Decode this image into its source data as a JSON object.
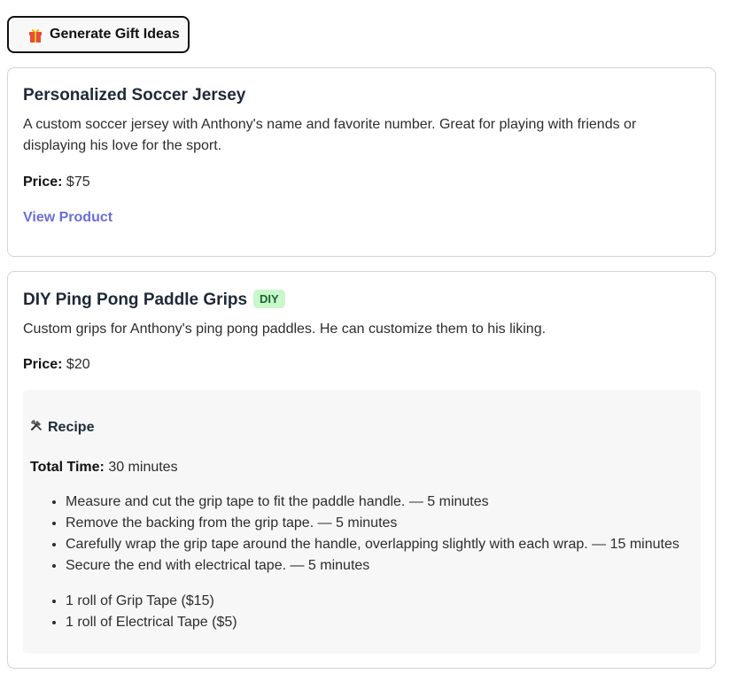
{
  "toolbar": {
    "generate_label": "Generate Gift Ideas",
    "generate_icon": "gift-icon"
  },
  "gifts": [
    {
      "title": "Personalized Soccer Jersey",
      "description": "A custom soccer jersey with Anthony's name and favorite number. Great for playing with friends or displaying his love for the sport.",
      "price_label": "Price:",
      "price": "$75",
      "link_label": "View Product"
    },
    {
      "title": "DIY Ping Pong Paddle Grips",
      "badge": "DIY",
      "description": "Custom grips for Anthony's ping pong paddles. He can customize them to his liking.",
      "price_label": "Price:",
      "price": "$20",
      "recipe": {
        "heading": "Recipe",
        "heading_icon": "tools-icon",
        "total_time_label": "Total Time:",
        "total_time": "30 minutes",
        "steps": [
          "Measure and cut the grip tape to fit the paddle handle. — 5 minutes",
          "Remove the backing from the grip tape. — 5 minutes",
          "Carefully wrap the grip tape around the handle, overlapping slightly with each wrap. — 15 minutes",
          "Secure the end with electrical tape. — 5 minutes"
        ],
        "materials": [
          "1 roll of Grip Tape ($15)",
          "1 roll of Electrical Tape ($5)"
        ]
      }
    }
  ],
  "colors": {
    "link": "#6b6fd6",
    "badge_bg": "#c9f7c9",
    "badge_text": "#166534",
    "recipe_bg": "#f7f7f7"
  }
}
